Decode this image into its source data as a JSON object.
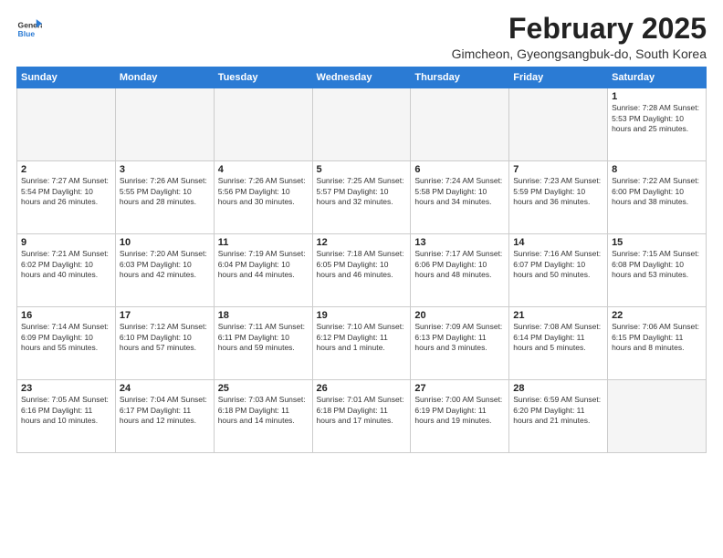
{
  "logo": {
    "line1": "General",
    "line2": "Blue"
  },
  "title": "February 2025",
  "subtitle": "Gimcheon, Gyeongsangbuk-do, South Korea",
  "weekdays": [
    "Sunday",
    "Monday",
    "Tuesday",
    "Wednesday",
    "Thursday",
    "Friday",
    "Saturday"
  ],
  "weeks": [
    [
      {
        "day": "",
        "info": ""
      },
      {
        "day": "",
        "info": ""
      },
      {
        "day": "",
        "info": ""
      },
      {
        "day": "",
        "info": ""
      },
      {
        "day": "",
        "info": ""
      },
      {
        "day": "",
        "info": ""
      },
      {
        "day": "1",
        "info": "Sunrise: 7:28 AM\nSunset: 5:53 PM\nDaylight: 10 hours and 25 minutes."
      }
    ],
    [
      {
        "day": "2",
        "info": "Sunrise: 7:27 AM\nSunset: 5:54 PM\nDaylight: 10 hours and 26 minutes."
      },
      {
        "day": "3",
        "info": "Sunrise: 7:26 AM\nSunset: 5:55 PM\nDaylight: 10 hours and 28 minutes."
      },
      {
        "day": "4",
        "info": "Sunrise: 7:26 AM\nSunset: 5:56 PM\nDaylight: 10 hours and 30 minutes."
      },
      {
        "day": "5",
        "info": "Sunrise: 7:25 AM\nSunset: 5:57 PM\nDaylight: 10 hours and 32 minutes."
      },
      {
        "day": "6",
        "info": "Sunrise: 7:24 AM\nSunset: 5:58 PM\nDaylight: 10 hours and 34 minutes."
      },
      {
        "day": "7",
        "info": "Sunrise: 7:23 AM\nSunset: 5:59 PM\nDaylight: 10 hours and 36 minutes."
      },
      {
        "day": "8",
        "info": "Sunrise: 7:22 AM\nSunset: 6:00 PM\nDaylight: 10 hours and 38 minutes."
      }
    ],
    [
      {
        "day": "9",
        "info": "Sunrise: 7:21 AM\nSunset: 6:02 PM\nDaylight: 10 hours and 40 minutes."
      },
      {
        "day": "10",
        "info": "Sunrise: 7:20 AM\nSunset: 6:03 PM\nDaylight: 10 hours and 42 minutes."
      },
      {
        "day": "11",
        "info": "Sunrise: 7:19 AM\nSunset: 6:04 PM\nDaylight: 10 hours and 44 minutes."
      },
      {
        "day": "12",
        "info": "Sunrise: 7:18 AM\nSunset: 6:05 PM\nDaylight: 10 hours and 46 minutes."
      },
      {
        "day": "13",
        "info": "Sunrise: 7:17 AM\nSunset: 6:06 PM\nDaylight: 10 hours and 48 minutes."
      },
      {
        "day": "14",
        "info": "Sunrise: 7:16 AM\nSunset: 6:07 PM\nDaylight: 10 hours and 50 minutes."
      },
      {
        "day": "15",
        "info": "Sunrise: 7:15 AM\nSunset: 6:08 PM\nDaylight: 10 hours and 53 minutes."
      }
    ],
    [
      {
        "day": "16",
        "info": "Sunrise: 7:14 AM\nSunset: 6:09 PM\nDaylight: 10 hours and 55 minutes."
      },
      {
        "day": "17",
        "info": "Sunrise: 7:12 AM\nSunset: 6:10 PM\nDaylight: 10 hours and 57 minutes."
      },
      {
        "day": "18",
        "info": "Sunrise: 7:11 AM\nSunset: 6:11 PM\nDaylight: 10 hours and 59 minutes."
      },
      {
        "day": "19",
        "info": "Sunrise: 7:10 AM\nSunset: 6:12 PM\nDaylight: 11 hours and 1 minute."
      },
      {
        "day": "20",
        "info": "Sunrise: 7:09 AM\nSunset: 6:13 PM\nDaylight: 11 hours and 3 minutes."
      },
      {
        "day": "21",
        "info": "Sunrise: 7:08 AM\nSunset: 6:14 PM\nDaylight: 11 hours and 5 minutes."
      },
      {
        "day": "22",
        "info": "Sunrise: 7:06 AM\nSunset: 6:15 PM\nDaylight: 11 hours and 8 minutes."
      }
    ],
    [
      {
        "day": "23",
        "info": "Sunrise: 7:05 AM\nSunset: 6:16 PM\nDaylight: 11 hours and 10 minutes."
      },
      {
        "day": "24",
        "info": "Sunrise: 7:04 AM\nSunset: 6:17 PM\nDaylight: 11 hours and 12 minutes."
      },
      {
        "day": "25",
        "info": "Sunrise: 7:03 AM\nSunset: 6:18 PM\nDaylight: 11 hours and 14 minutes."
      },
      {
        "day": "26",
        "info": "Sunrise: 7:01 AM\nSunset: 6:18 PM\nDaylight: 11 hours and 17 minutes."
      },
      {
        "day": "27",
        "info": "Sunrise: 7:00 AM\nSunset: 6:19 PM\nDaylight: 11 hours and 19 minutes."
      },
      {
        "day": "28",
        "info": "Sunrise: 6:59 AM\nSunset: 6:20 PM\nDaylight: 11 hours and 21 minutes."
      },
      {
        "day": "",
        "info": ""
      }
    ]
  ]
}
